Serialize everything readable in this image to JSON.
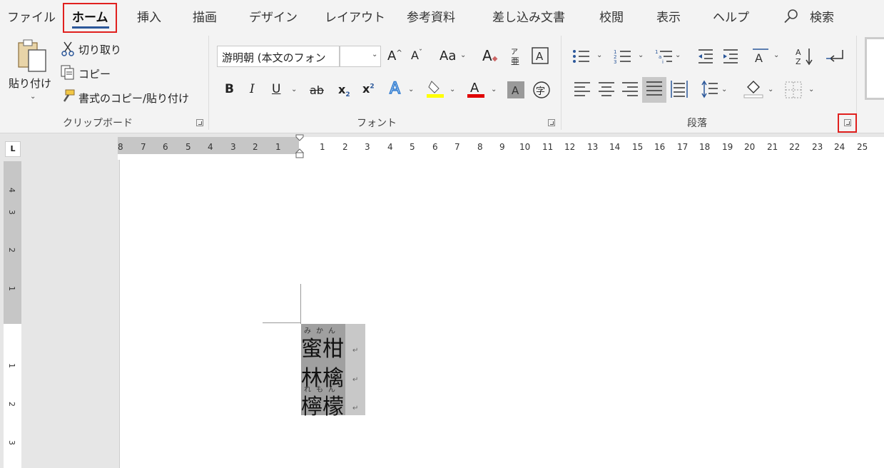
{
  "tabs": [
    {
      "label": "ファイル",
      "active": false
    },
    {
      "label": "ホーム",
      "active": true
    },
    {
      "label": "挿入",
      "active": false
    },
    {
      "label": "描画",
      "active": false
    },
    {
      "label": "デザイン",
      "active": false
    },
    {
      "label": "レイアウト",
      "active": false
    },
    {
      "label": "参考資料",
      "active": false
    },
    {
      "label": "差し込み文書",
      "active": false
    },
    {
      "label": "校閲",
      "active": false
    },
    {
      "label": "表示",
      "active": false
    },
    {
      "label": "ヘルプ",
      "active": false
    }
  ],
  "search": {
    "label": "検索",
    "icon": "search-icon"
  },
  "clipboard": {
    "group_label": "クリップボード",
    "paste_label": "貼り付け",
    "cut_label": "切り取り",
    "copy_label": "コピー",
    "format_painter_label": "書式のコピー/貼り付け"
  },
  "font": {
    "group_label": "フォント",
    "font_name": "游明朝 (本文のフォン",
    "font_size": "",
    "ruby_icon_top": "ア",
    "ruby_icon_bottom": "亜",
    "case_label": "Aa",
    "bold": "B",
    "italic": "I",
    "underline": "U",
    "strike": "ab",
    "subscript": "x",
    "superscript": "x",
    "enclose_char": "字",
    "highlight_color": "#ffff00",
    "font_color": "#e00000"
  },
  "paragraph": {
    "group_label": "段落"
  },
  "ruler": {
    "left_numbers": [
      "8",
      "7",
      "6",
      "5",
      "4",
      "3",
      "2",
      "1"
    ],
    "right_numbers": [
      "1",
      "2",
      "3",
      "4",
      "5",
      "6",
      "7",
      "8",
      "9",
      "10",
      "11",
      "12",
      "13",
      "14",
      "15",
      "16",
      "17",
      "18",
      "19",
      "20",
      "21",
      "22",
      "23",
      "24",
      "25"
    ],
    "vertical_numbers": [
      "4",
      "3",
      "2",
      "1",
      "1",
      "2",
      "3"
    ],
    "tab_selector": "L"
  },
  "document": {
    "lines": [
      {
        "ruby": "みかん",
        "text": "蜜柑",
        "mark": "↵"
      },
      {
        "ruby": "",
        "text": "林檎",
        "mark": "↵"
      },
      {
        "ruby": "れもん",
        "text": "檸檬",
        "mark": "↵"
      }
    ]
  },
  "colors": {
    "highlight_box": "#e0201e",
    "accent": "#2b579a"
  }
}
